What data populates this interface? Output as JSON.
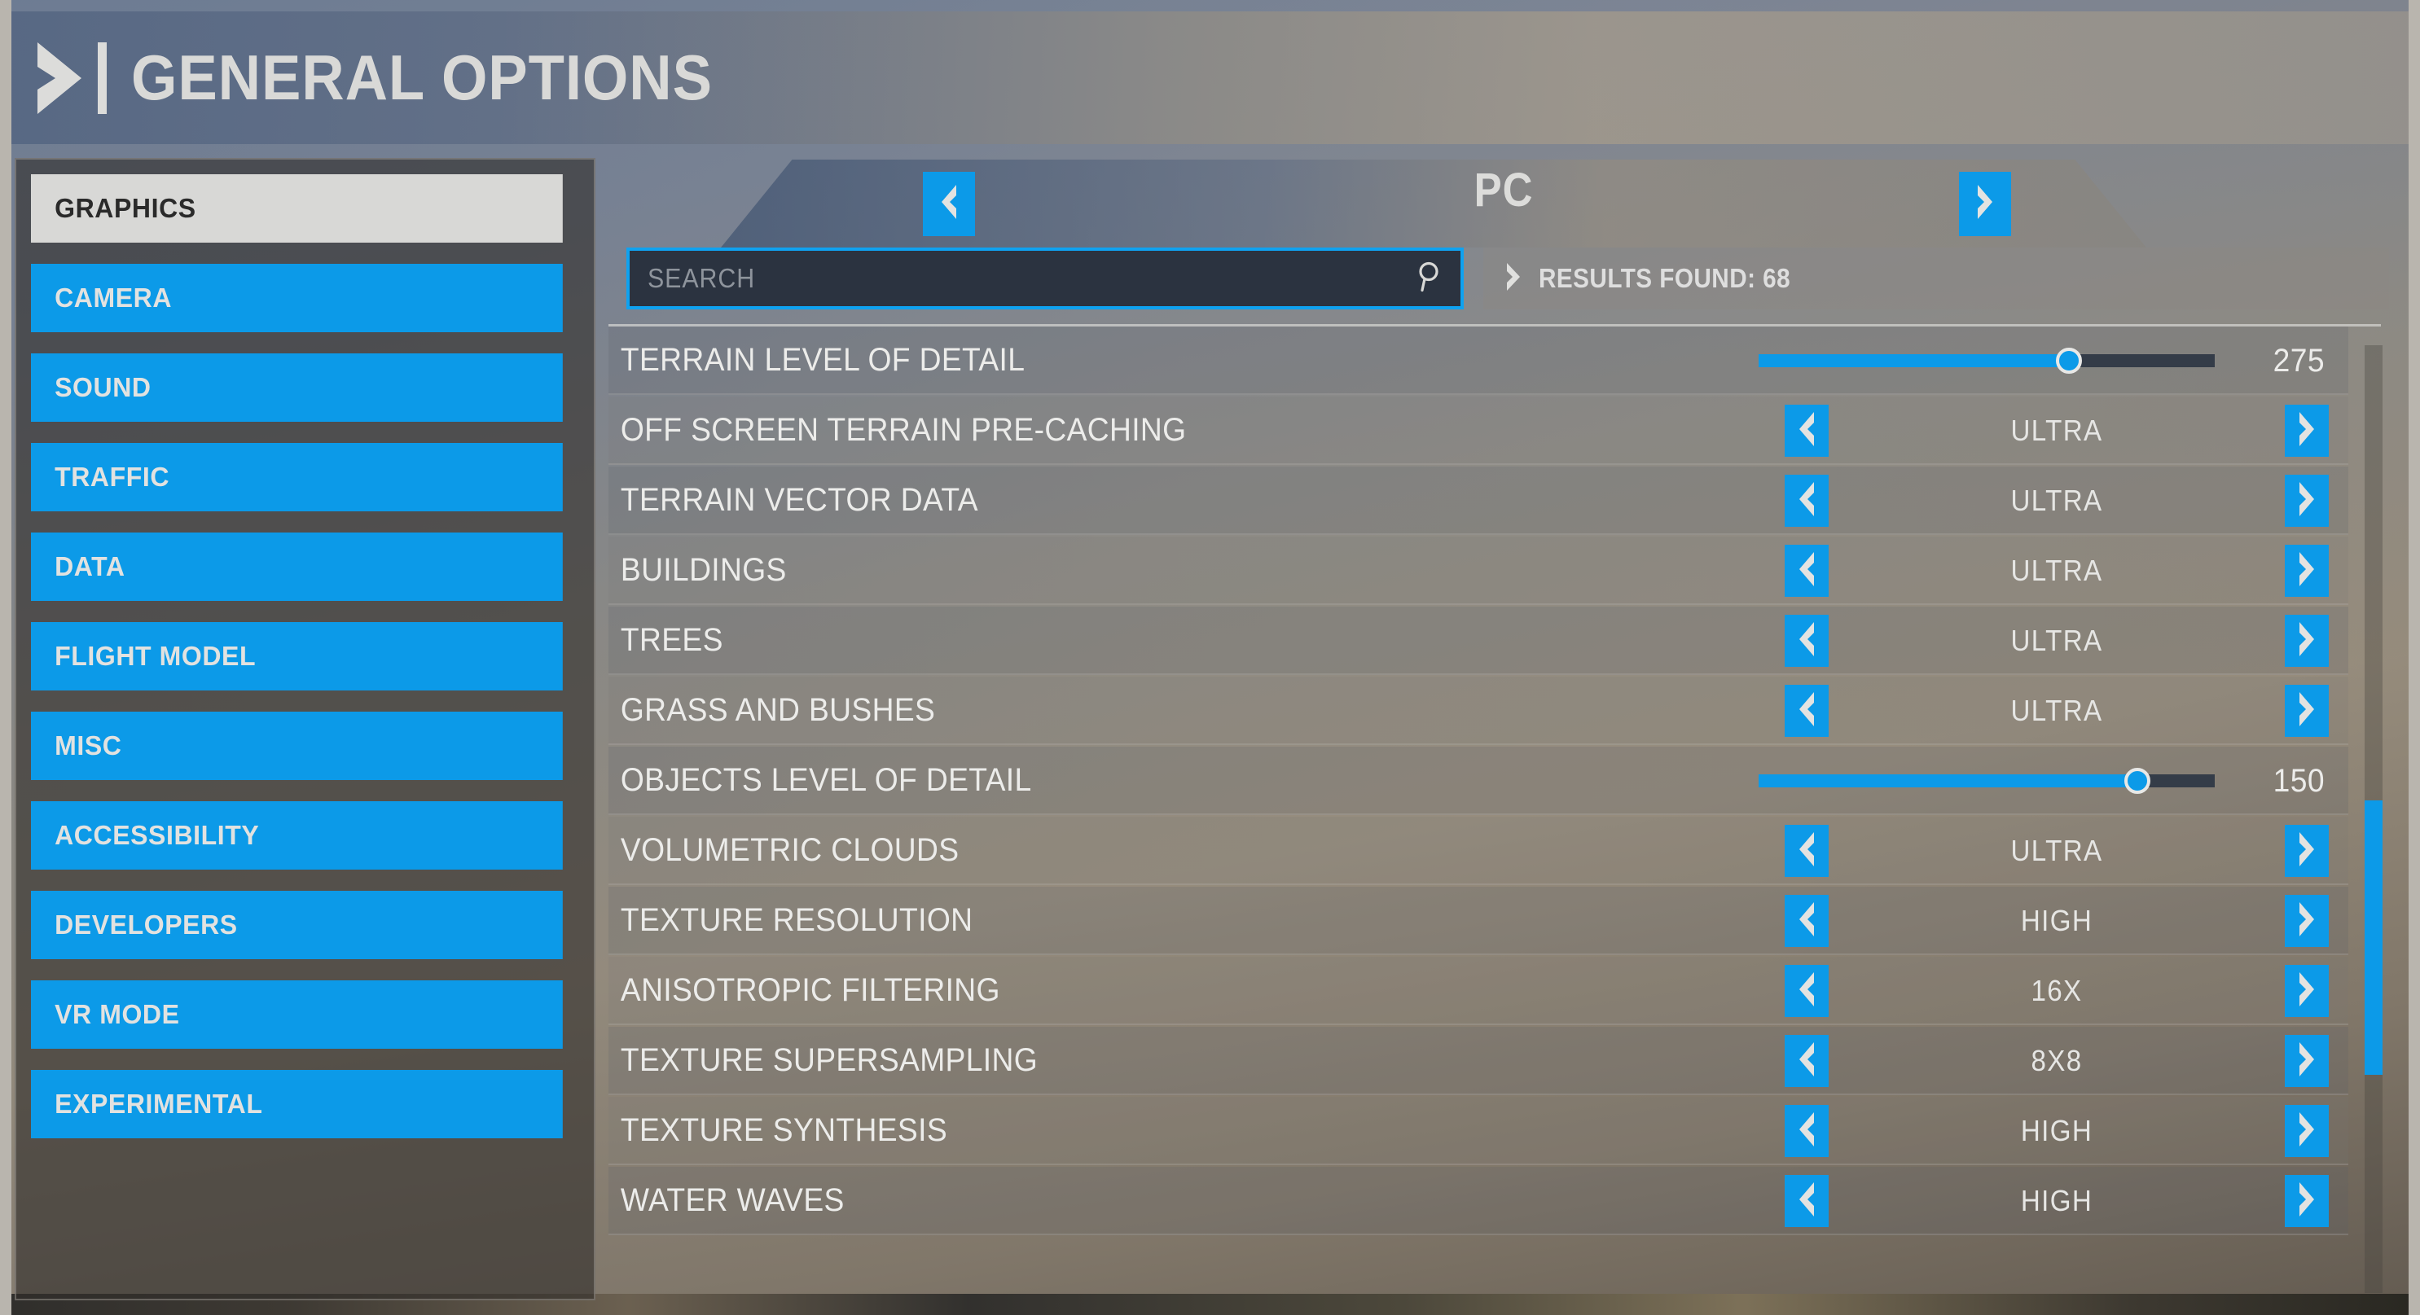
{
  "header": {
    "title": "GENERAL OPTIONS",
    "chevron_icon": "chevron-right-icon",
    "divider_icon": "vertical-bar"
  },
  "sidebar": {
    "items": [
      {
        "label": "GRAPHICS",
        "active": true
      },
      {
        "label": "CAMERA",
        "active": false
      },
      {
        "label": "SOUND",
        "active": false
      },
      {
        "label": "TRAFFIC",
        "active": false
      },
      {
        "label": "DATA",
        "active": false
      },
      {
        "label": "FLIGHT MODEL",
        "active": false
      },
      {
        "label": "MISC",
        "active": false
      },
      {
        "label": "ACCESSIBILITY",
        "active": false
      },
      {
        "label": "DEVELOPERS",
        "active": false
      },
      {
        "label": "VR MODE",
        "active": false
      },
      {
        "label": "EXPERIMENTAL",
        "active": false
      }
    ]
  },
  "profile_selector": {
    "value": "PC",
    "prev_icon": "chevron-left-icon",
    "next_icon": "chevron-right-icon"
  },
  "search": {
    "placeholder": "SEARCH",
    "value": "",
    "icon": "search-icon"
  },
  "results": {
    "chevron_icon": "chevron-right-icon",
    "text": "RESULTS FOUND: 68",
    "count": 68
  },
  "settings": [
    {
      "label": "TERRAIN LEVEL OF DETAIL",
      "type": "slider",
      "value": "275",
      "percent": 68
    },
    {
      "label": "OFF SCREEN TERRAIN PRE-CACHING",
      "type": "stepper",
      "value": "ULTRA"
    },
    {
      "label": "TERRAIN VECTOR DATA",
      "type": "stepper",
      "value": "ULTRA"
    },
    {
      "label": "BUILDINGS",
      "type": "stepper",
      "value": "ULTRA"
    },
    {
      "label": "TREES",
      "type": "stepper",
      "value": "ULTRA"
    },
    {
      "label": "GRASS AND BUSHES",
      "type": "stepper",
      "value": "ULTRA"
    },
    {
      "label": "OBJECTS LEVEL OF DETAIL",
      "type": "slider",
      "value": "150",
      "percent": 83
    },
    {
      "label": "VOLUMETRIC CLOUDS",
      "type": "stepper",
      "value": "ULTRA"
    },
    {
      "label": "TEXTURE RESOLUTION",
      "type": "stepper",
      "value": "HIGH"
    },
    {
      "label": "ANISOTROPIC FILTERING",
      "type": "stepper",
      "value": "16X"
    },
    {
      "label": "TEXTURE SUPERSAMPLING",
      "type": "stepper",
      "value": "8X8"
    },
    {
      "label": "TEXTURE SYNTHESIS",
      "type": "stepper",
      "value": "HIGH"
    },
    {
      "label": "WATER WAVES",
      "type": "stepper",
      "value": "HIGH"
    }
  ],
  "scrollbar": {
    "thumb_top_pct": 48,
    "thumb_height_pct": 29
  },
  "colors": {
    "accent_blue": "#0c9ae8",
    "active_item_bg": "#d8d8d6",
    "text_light": "#ececea",
    "search_bg": "#2b3340",
    "track_unfilled": "#343c48"
  }
}
